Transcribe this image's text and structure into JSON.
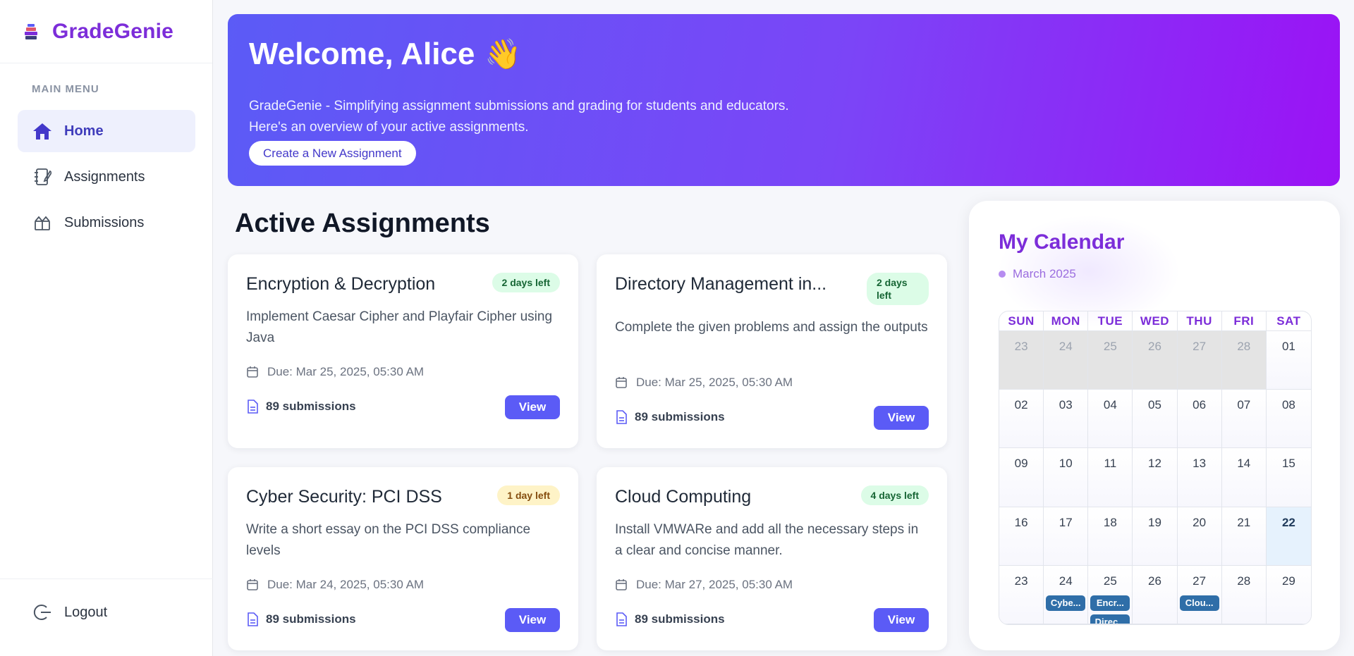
{
  "brand": {
    "name": "GradeGenie",
    "logo_icon": "books-stack-icon"
  },
  "sidebar": {
    "section_label": "MAIN MENU",
    "items": [
      {
        "label": "Home",
        "icon": "home-icon",
        "active": true
      },
      {
        "label": "Assignments",
        "icon": "notebook-icon",
        "active": false
      },
      {
        "label": "Submissions",
        "icon": "box-icon",
        "active": false
      }
    ],
    "logout_label": "Logout"
  },
  "hero": {
    "title": "Welcome, Alice",
    "emoji": "👋",
    "line1": "GradeGenie - Simplifying assignment submissions and grading for students and educators.",
    "line2": "Here's an overview of your active assignments.",
    "cta": "Create a New Assignment"
  },
  "active_assignments": {
    "title": "Active Assignments",
    "view_label": "View",
    "cards": [
      {
        "title": "Encryption & Decryption",
        "badge": "2 days left",
        "badge_color": "#dcfce7",
        "description": "Implement Caesar Cipher and Playfair Cipher using Java",
        "due": "Due: Mar 25, 2025, 05:30 AM",
        "submissions": "89 submissions"
      },
      {
        "title": "Directory Management in...",
        "badge": "2 days left",
        "badge_color": "#dcfce7",
        "description": "Complete the given problems and assign the outputs",
        "due": "Due: Mar 25, 2025, 05:30 AM",
        "submissions": "89 submissions"
      },
      {
        "title": "Cyber Security: PCI DSS",
        "badge": "1 day left",
        "badge_color": "#fef3c7",
        "description": "Write a short essay on the PCI DSS compliance levels",
        "due": "Due: Mar 24, 2025, 05:30 AM",
        "submissions": "89 submissions"
      },
      {
        "title": "Cloud Computing",
        "badge": "4 days left",
        "badge_color": "#dcfce7",
        "description": "Install VMWARe and add all the necessary steps in a clear and concise manner.",
        "due": "Due: Mar 27, 2025, 05:30 AM",
        "submissions": "89 submissions"
      }
    ]
  },
  "calendar": {
    "title": "My Calendar",
    "month": "March 2025",
    "weekdays": [
      "SUN",
      "MON",
      "TUE",
      "WED",
      "THU",
      "FRI",
      "SAT"
    ],
    "weeks": [
      [
        "23",
        "24",
        "25",
        "26",
        "27",
        "28",
        "01"
      ],
      [
        "02",
        "03",
        "04",
        "05",
        "06",
        "07",
        "08"
      ],
      [
        "09",
        "10",
        "11",
        "12",
        "13",
        "14",
        "15"
      ],
      [
        "16",
        "17",
        "18",
        "19",
        "20",
        "21",
        "22"
      ],
      [
        "23",
        "24",
        "25",
        "26",
        "27",
        "28",
        "29"
      ]
    ],
    "outside_days_first_week": 6,
    "today": "22",
    "events": [
      {
        "day": "24",
        "labels": [
          "Cybe..."
        ]
      },
      {
        "day": "25",
        "labels": [
          "Encr...",
          "Direc..."
        ]
      },
      {
        "day": "27",
        "labels": [
          "Clou..."
        ]
      }
    ]
  },
  "colors": {
    "accent": "#5b5bf6",
    "brand": "#7c2dd9",
    "event": "#2f6ea8"
  }
}
